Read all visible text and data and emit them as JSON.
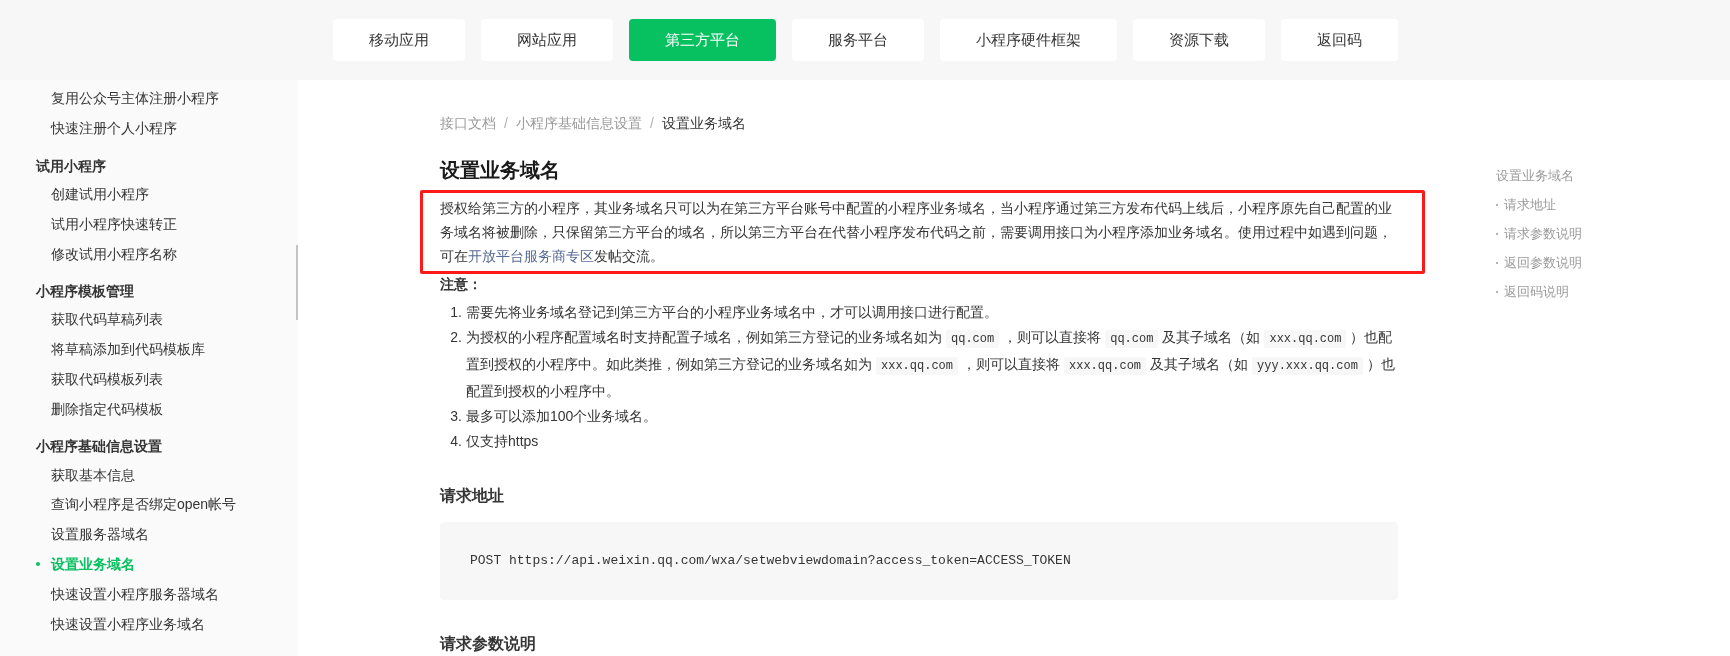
{
  "nav_tabs": [
    {
      "label": "移动应用",
      "selected": false
    },
    {
      "label": "网站应用",
      "selected": false
    },
    {
      "label": "第三方平台",
      "selected": true
    },
    {
      "label": "服务平台",
      "selected": false
    },
    {
      "label": "小程序硬件框架",
      "selected": false
    },
    {
      "label": "资源下载",
      "selected": false
    },
    {
      "label": "返回码",
      "selected": false
    }
  ],
  "sidebar": {
    "groups": [
      {
        "items": [
          {
            "label": "复用公众号主体注册小程序",
            "selected": false
          },
          {
            "label": "快速注册个人小程序",
            "selected": false
          }
        ]
      },
      {
        "title": "试用小程序",
        "items": [
          {
            "label": "创建试用小程序",
            "selected": false
          },
          {
            "label": "试用小程序快速转正",
            "selected": false
          },
          {
            "label": "修改试用小程序名称",
            "selected": false
          }
        ]
      },
      {
        "title": "小程序模板管理",
        "items": [
          {
            "label": "获取代码草稿列表",
            "selected": false
          },
          {
            "label": "将草稿添加到代码模板库",
            "selected": false
          },
          {
            "label": "获取代码模板列表",
            "selected": false
          },
          {
            "label": "删除指定代码模板",
            "selected": false
          }
        ]
      },
      {
        "title": "小程序基础信息设置",
        "items": [
          {
            "label": "获取基本信息",
            "selected": false
          },
          {
            "label": "查询小程序是否绑定open帐号",
            "selected": false
          },
          {
            "label": "设置服务器域名",
            "selected": false
          },
          {
            "label": "设置业务域名",
            "selected": true
          },
          {
            "label": "快速设置小程序服务器域名",
            "selected": false
          },
          {
            "label": "快速设置小程序业务域名",
            "selected": false
          }
        ]
      }
    ]
  },
  "breadcrumb": {
    "separator": "/",
    "items": [
      "接口文档",
      "小程序基础信息设置",
      "设置业务域名"
    ]
  },
  "title": "设置业务域名",
  "intro": [
    {
      "kind": "text",
      "text": "授权给第三方的小程序，其业务域名只可以为在第三方平台账号中配置的小程序业务域名，当小程序通过第三方发布代码上线后，小程序原先自己配置的业务域名将被删除，只保留第三方平台的域名，所以第三方平台在代替小程序发布代码之前，需要调用接口为小程序添加业务域名。使用过程中如遇到问题，可在"
    },
    {
      "kind": "link",
      "text": "开放平台服务商专区"
    },
    {
      "kind": "text",
      "text": "发帖交流。"
    }
  ],
  "note_label": "注意：",
  "notes": [
    {
      "number": "1.",
      "parts": [
        {
          "kind": "text",
          "text": "需要先将业务域名登记到第三方平台的小程序业务域名中，才可以调用接口进行配置。"
        }
      ]
    },
    {
      "number": "2.",
      "parts": [
        {
          "kind": "text",
          "text": "为授权的小程序配置域名时支持配置子域名，例如第三方登记的业务域名如为"
        },
        {
          "kind": "code",
          "text": "qq.com"
        },
        {
          "kind": "text",
          "text": "，则可以直接将"
        },
        {
          "kind": "code",
          "text": "qq.com"
        },
        {
          "kind": "text",
          "text": "及其子域名（如"
        },
        {
          "kind": "code",
          "text": "xxx.qq.com"
        },
        {
          "kind": "text",
          "text": "）也配置到授权的小程序中。如此类推，例如第三方登记的业务域名如为"
        },
        {
          "kind": "code",
          "text": "xxx.qq.com"
        },
        {
          "kind": "text",
          "text": "，则可以直接将"
        },
        {
          "kind": "code",
          "text": "xxx.qq.com"
        },
        {
          "kind": "text",
          "text": "及其子域名（如"
        },
        {
          "kind": "code",
          "text": "yyy.xxx.qq.com"
        },
        {
          "kind": "text",
          "text": "）也配置到授权的小程序中。"
        }
      ]
    },
    {
      "number": "3.",
      "parts": [
        {
          "kind": "text",
          "text": "最多可以添加100个业务域名。"
        }
      ]
    },
    {
      "number": "4.",
      "parts": [
        {
          "kind": "text",
          "text": "仅支持https"
        }
      ]
    }
  ],
  "request_section": {
    "title": "请求地址",
    "code": "POST https://api.weixin.qq.com/wxa/setwebviewdomain?access_token=ACCESS_TOKEN"
  },
  "next_section_title": "请求参数说明",
  "toc": [
    {
      "label": "设置业务域名",
      "kind": "title"
    },
    {
      "label": "请求地址",
      "kind": "sub"
    },
    {
      "label": "请求参数说明",
      "kind": "sub"
    },
    {
      "label": "返回参数说明",
      "kind": "sub"
    },
    {
      "label": "返回码说明",
      "kind": "sub"
    }
  ]
}
